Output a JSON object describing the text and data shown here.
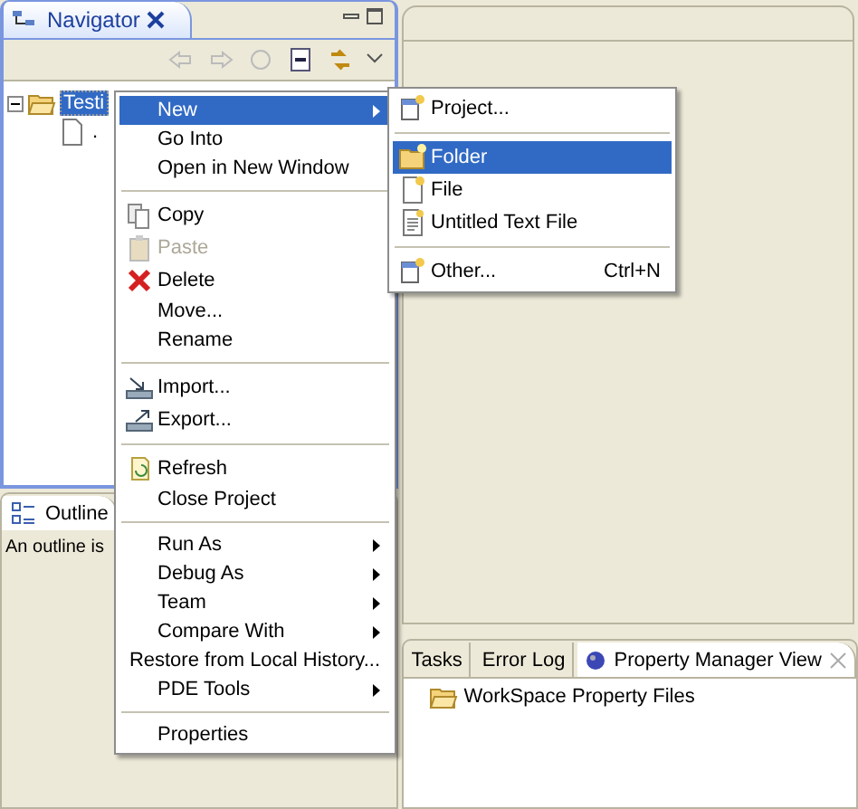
{
  "navigator": {
    "title": "Navigator",
    "tree": [
      {
        "label": "Testi",
        "selected": true,
        "expanded": true,
        "children": [
          {
            "label": "."
          }
        ]
      }
    ]
  },
  "outline": {
    "title": "Outline",
    "message": "An outline is"
  },
  "bottom_panel": {
    "tabs": [
      {
        "label": "Tasks",
        "selected": false
      },
      {
        "label": "Error Log",
        "selected": false
      },
      {
        "label": "Property Manager View",
        "selected": true
      }
    ],
    "tree": [
      {
        "label": "WorkSpace Property Files"
      }
    ]
  },
  "context_menu": {
    "items": [
      {
        "kind": "item",
        "label": "New",
        "selected": true,
        "disabled": false,
        "submenu": true
      },
      {
        "kind": "item",
        "label": "Go Into",
        "selected": false,
        "disabled": false,
        "submenu": false
      },
      {
        "kind": "item",
        "label": "Open in New Window",
        "selected": false,
        "disabled": false,
        "submenu": false
      },
      {
        "kind": "separator"
      },
      {
        "kind": "item",
        "label": "Copy",
        "selected": false,
        "disabled": false,
        "submenu": false
      },
      {
        "kind": "item",
        "label": "Paste",
        "selected": false,
        "disabled": true,
        "submenu": false
      },
      {
        "kind": "item",
        "label": "Delete",
        "selected": false,
        "disabled": false,
        "submenu": false
      },
      {
        "kind": "item",
        "label": "Move...",
        "selected": false,
        "disabled": false,
        "submenu": false
      },
      {
        "kind": "item",
        "label": "Rename",
        "selected": false,
        "disabled": false,
        "submenu": false
      },
      {
        "kind": "separator"
      },
      {
        "kind": "item",
        "label": "Import...",
        "selected": false,
        "disabled": false,
        "submenu": false
      },
      {
        "kind": "item",
        "label": "Export...",
        "selected": false,
        "disabled": false,
        "submenu": false
      },
      {
        "kind": "separator"
      },
      {
        "kind": "item",
        "label": "Refresh",
        "selected": false,
        "disabled": false,
        "submenu": false
      },
      {
        "kind": "item",
        "label": "Close Project",
        "selected": false,
        "disabled": false,
        "submenu": false
      },
      {
        "kind": "separator"
      },
      {
        "kind": "item",
        "label": "Run As",
        "selected": false,
        "disabled": false,
        "submenu": true
      },
      {
        "kind": "item",
        "label": "Debug As",
        "selected": false,
        "disabled": false,
        "submenu": true
      },
      {
        "kind": "item",
        "label": "Team",
        "selected": false,
        "disabled": false,
        "submenu": true
      },
      {
        "kind": "item",
        "label": "Compare With",
        "selected": false,
        "disabled": false,
        "submenu": true
      },
      {
        "kind": "item",
        "label": "Restore from Local History...",
        "selected": false,
        "disabled": false,
        "submenu": false
      },
      {
        "kind": "item",
        "label": "PDE Tools",
        "selected": false,
        "disabled": false,
        "submenu": true
      },
      {
        "kind": "separator"
      },
      {
        "kind": "item",
        "label": "Properties",
        "selected": false,
        "disabled": false,
        "submenu": false
      }
    ]
  },
  "submenu": {
    "items": [
      {
        "kind": "item",
        "label": "Project...",
        "selected": false
      },
      {
        "kind": "separator"
      },
      {
        "kind": "item",
        "label": "Folder",
        "selected": true
      },
      {
        "kind": "item",
        "label": "File",
        "selected": false
      },
      {
        "kind": "item",
        "label": "Untitled Text File",
        "selected": false
      },
      {
        "kind": "separator"
      },
      {
        "kind": "item",
        "label": "Other...",
        "selected": false,
        "shortcut": "Ctrl+N"
      }
    ]
  }
}
